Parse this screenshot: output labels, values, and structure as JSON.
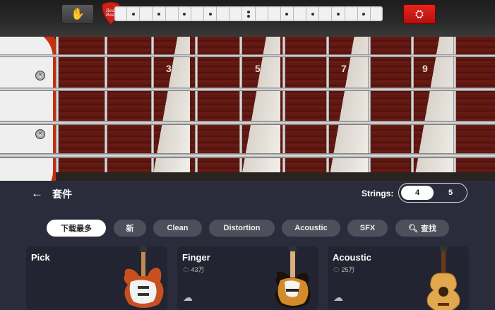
{
  "topbar": {
    "hand_icon": "hand-icon",
    "logo_text": "Real Bass",
    "settings_icon": "settings-icon"
  },
  "fretboard": {
    "fret_numbers": [
      "3",
      "5",
      "7",
      "9"
    ]
  },
  "panel": {
    "title": "套件",
    "strings_label": "Strings:",
    "strings_options": [
      "4",
      "5"
    ],
    "strings_selected": "4"
  },
  "filters": [
    {
      "label": "下载最多",
      "selected": true
    },
    {
      "label": "新",
      "selected": false
    },
    {
      "label": "Clean",
      "selected": false
    },
    {
      "label": "Distortion",
      "selected": false
    },
    {
      "label": "Acoustic",
      "selected": false
    },
    {
      "label": "SFX",
      "selected": false
    },
    {
      "label": "查找",
      "selected": false
    }
  ],
  "kits": [
    {
      "name": "Pick",
      "count": ""
    },
    {
      "name": "Finger",
      "count": "43万"
    },
    {
      "name": "Acoustic",
      "count": "25万"
    }
  ],
  "colors": {
    "panel_bg": "#2b2c3b",
    "chip_bg": "#4f4f5c",
    "accent_red": "#d8231a"
  }
}
